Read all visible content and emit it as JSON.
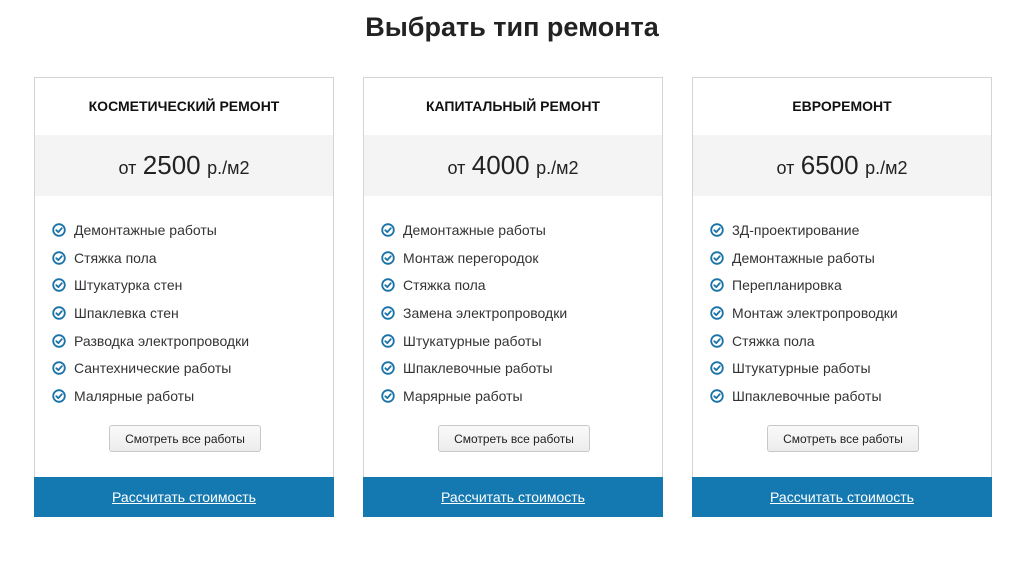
{
  "page": {
    "title": "Выбрать тип ремонта"
  },
  "cards": [
    {
      "title": "КОСМЕТИЧЕСКИЙ РЕМОНТ",
      "price_prefix": "от",
      "price_value": "2500",
      "price_unit": "р./м2",
      "features": [
        "Демонтажные работы",
        "Стяжка пола",
        "Штукатурка стен",
        "Шпаклевка стен",
        "Разводка электропроводки",
        "Сантехнические работы",
        "Малярные работы"
      ],
      "more_button": "Смотреть все работы",
      "calc_link": "Рассчитать стоимость"
    },
    {
      "title": "КАПИТАЛЬНЫЙ РЕМОНТ",
      "price_prefix": "от",
      "price_value": "4000",
      "price_unit": "р./м2",
      "features": [
        "Демонтажные работы",
        "Монтаж перегородок",
        "Стяжка пола",
        "Замена электропроводки",
        "Штукатурные работы",
        "Шпаклевочные работы",
        "Марярные работы"
      ],
      "more_button": "Смотреть все работы",
      "calc_link": "Рассчитать стоимость"
    },
    {
      "title": "ЕВРОРЕМОНТ",
      "price_prefix": "от",
      "price_value": "6500",
      "price_unit": "р./м2",
      "features": [
        "3Д-проектирование",
        "Демонтажные работы",
        "Перепланировка",
        "Монтаж электропроводки",
        "Стяжка пола",
        "Штукатурные работы",
        "Шпаклевочные работы"
      ],
      "more_button": "Смотреть все работы",
      "calc_link": "Рассчитать стоимость"
    }
  ],
  "icons": {
    "feature_icon": "check-circle-icon"
  },
  "colors": {
    "accent": "#1479b1",
    "check": "#1a73a8",
    "price_bg": "#f4f4f4",
    "border": "#d4d4d4"
  }
}
